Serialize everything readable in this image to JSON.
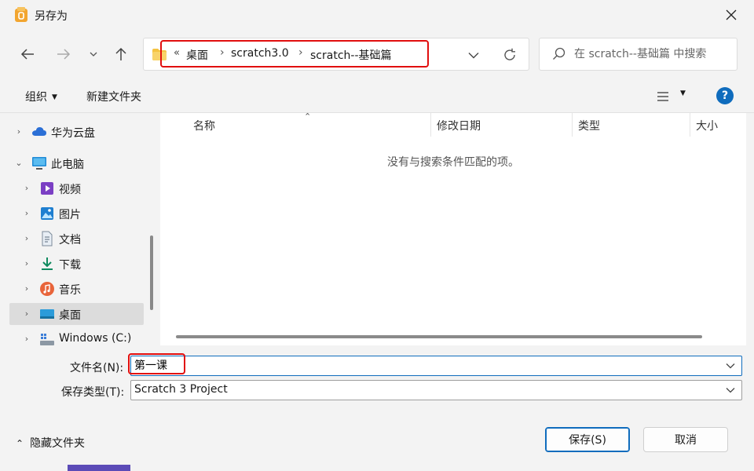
{
  "window": {
    "title": "另存为",
    "close_label": "✕"
  },
  "address_bar": {
    "overflow_marker": "«",
    "crumbs": [
      {
        "label": "桌面"
      },
      {
        "label": "scratch3.0"
      },
      {
        "label": "scratch--基础篇"
      }
    ],
    "separator": "›"
  },
  "search": {
    "placeholder": "在 scratch--基础篇 中搜索"
  },
  "toolbar": {
    "organize_label": "组织",
    "new_folder_label": "新建文件夹",
    "help_label": "?"
  },
  "nav_pane": {
    "items": [
      {
        "label": "华为云盘",
        "icon": "cloud-icon"
      },
      {
        "label": "此电脑",
        "icon": "computer-icon",
        "expanded": true
      },
      {
        "label": "视频",
        "icon": "video-icon"
      },
      {
        "label": "图片",
        "icon": "picture-icon"
      },
      {
        "label": "文档",
        "icon": "document-icon"
      },
      {
        "label": "下载",
        "icon": "download-icon"
      },
      {
        "label": "音乐",
        "icon": "music-icon"
      },
      {
        "label": "桌面",
        "icon": "desktop-icon",
        "selected": true
      },
      {
        "label": "Windows (C:)",
        "icon": "drive-icon"
      }
    ]
  },
  "file_list": {
    "columns": [
      {
        "label": "名称"
      },
      {
        "label": "修改日期"
      },
      {
        "label": "类型"
      },
      {
        "label": "大小"
      }
    ],
    "empty_message": "没有与搜索条件匹配的项。"
  },
  "save_form": {
    "filename_label": "文件名(N):",
    "filename_value": "第一课",
    "filetype_label": "保存类型(T):",
    "filetype_value": "Scratch 3 Project"
  },
  "footer": {
    "hide_folders_label": "隐藏文件夹",
    "save_label": "保存(S)",
    "cancel_label": "取消"
  },
  "colors": {
    "accent": "#0f6cbd",
    "highlight_annotation": "#e10e0e",
    "window_bg": "#f3f3f3",
    "selected_item": "#dcdcdc"
  }
}
